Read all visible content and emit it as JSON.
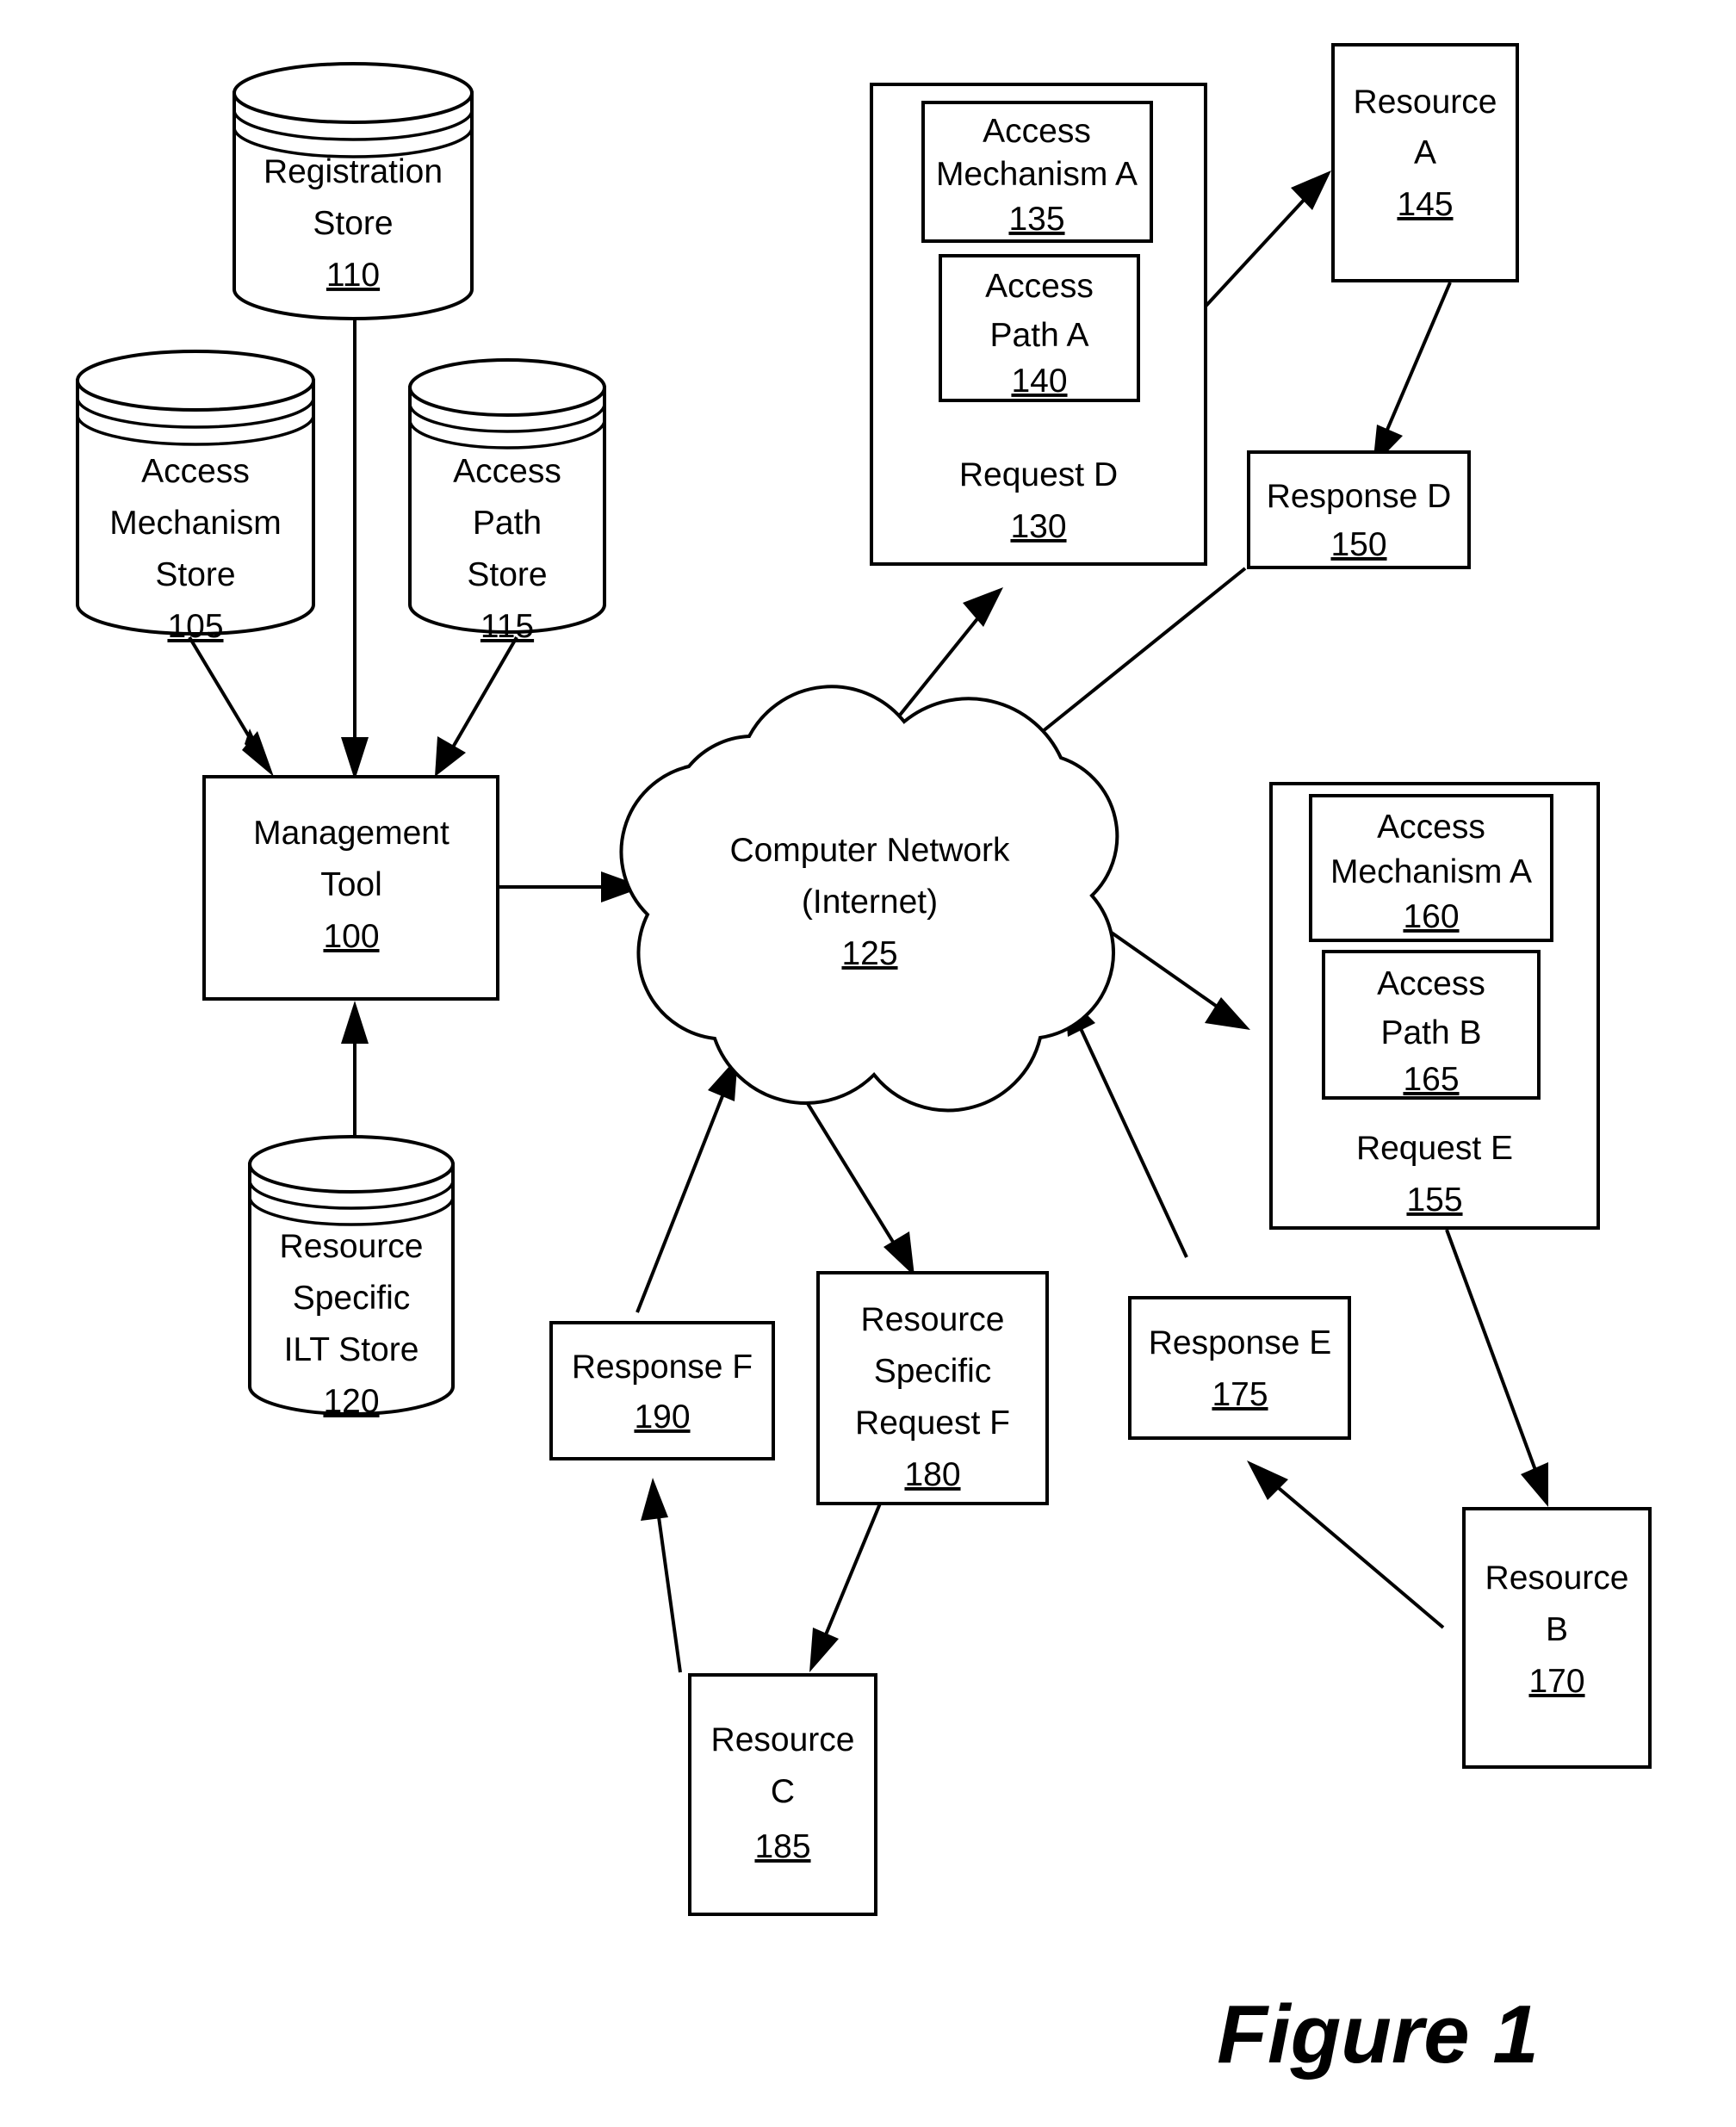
{
  "figure": {
    "caption": "Figure 1"
  },
  "nodes": {
    "registration_store": {
      "shape": "cylinder",
      "lines": [
        "Registration",
        "Store"
      ],
      "ref": "110"
    },
    "access_mechanism_store": {
      "shape": "cylinder",
      "lines": [
        "Access",
        "Mechanism",
        "Store"
      ],
      "ref": "105"
    },
    "access_path_store": {
      "shape": "cylinder",
      "lines": [
        "Access",
        "Path",
        "Store"
      ],
      "ref": "115"
    },
    "resource_specific_ilt_store": {
      "shape": "cylinder",
      "lines": [
        "Resource",
        "Specific",
        "ILT Store"
      ],
      "ref": "120"
    },
    "management_tool": {
      "shape": "rect",
      "lines": [
        "Management",
        "Tool"
      ],
      "ref": "100"
    },
    "computer_network": {
      "shape": "cloud",
      "lines": [
        "Computer Network",
        "(Internet)"
      ],
      "ref": "125"
    },
    "request_d": {
      "shape": "rect",
      "lines": [
        "Request D"
      ],
      "ref": "130"
    },
    "access_mechanism_a_135": {
      "shape": "rect",
      "lines": [
        "Access",
        "Mechanism A"
      ],
      "ref": "135"
    },
    "access_path_a_140": {
      "shape": "rect",
      "lines": [
        "Access",
        "Path A"
      ],
      "ref": "140"
    },
    "resource_a": {
      "shape": "rect",
      "lines": [
        "Resource",
        "A"
      ],
      "ref": "145"
    },
    "response_d": {
      "shape": "rect",
      "lines": [
        "Response D"
      ],
      "ref": "150"
    },
    "request_e": {
      "shape": "rect",
      "lines": [
        "Request E"
      ],
      "ref": "155"
    },
    "access_mechanism_a_160": {
      "shape": "rect",
      "lines": [
        "Access",
        "Mechanism A"
      ],
      "ref": "160"
    },
    "access_path_b_165": {
      "shape": "rect",
      "lines": [
        "Access",
        "Path B"
      ],
      "ref": "165"
    },
    "resource_b": {
      "shape": "rect",
      "lines": [
        "Resource",
        "B"
      ],
      "ref": "170"
    },
    "response_e": {
      "shape": "rect",
      "lines": [
        "Response E"
      ],
      "ref": "175"
    },
    "resource_specific_request_f": {
      "shape": "rect",
      "lines": [
        "Resource",
        "Specific",
        "Request F"
      ],
      "ref": "180"
    },
    "resource_c": {
      "shape": "rect",
      "lines": [
        "Resource",
        "C"
      ],
      "ref": "185"
    },
    "response_f": {
      "shape": "rect",
      "lines": [
        "Response F"
      ],
      "ref": "190"
    }
  },
  "edges": [
    {
      "from": "access_mechanism_store",
      "to": "management_tool",
      "arrow": "to"
    },
    {
      "from": "access_path_store",
      "to": "management_tool",
      "arrow": "to"
    },
    {
      "from": "management_tool",
      "to": "registration_store",
      "arrow": "both"
    },
    {
      "from": "resource_specific_ilt_store",
      "to": "management_tool",
      "arrow": "to"
    },
    {
      "from": "management_tool",
      "to": "computer_network",
      "arrow": "to"
    },
    {
      "from": "computer_network",
      "to": "request_d",
      "arrow": "to"
    },
    {
      "from": "request_d",
      "to": "resource_a",
      "arrow": "to"
    },
    {
      "from": "resource_a",
      "to": "response_d",
      "arrow": "to"
    },
    {
      "from": "response_d",
      "to": "computer_network",
      "arrow": "to"
    },
    {
      "from": "computer_network",
      "to": "request_e",
      "arrow": "to"
    },
    {
      "from": "request_e",
      "to": "resource_b",
      "arrow": "to"
    },
    {
      "from": "resource_b",
      "to": "response_e",
      "arrow": "to"
    },
    {
      "from": "response_e",
      "to": "computer_network",
      "arrow": "to"
    },
    {
      "from": "computer_network",
      "to": "resource_specific_request_f",
      "arrow": "to"
    },
    {
      "from": "resource_specific_request_f",
      "to": "resource_c",
      "arrow": "to"
    },
    {
      "from": "resource_c",
      "to": "response_f",
      "arrow": "to"
    },
    {
      "from": "response_f",
      "to": "computer_network",
      "arrow": "to"
    }
  ],
  "colors": {
    "stroke": "#000000",
    "fill": "#ffffff",
    "background": "#ffffff"
  }
}
